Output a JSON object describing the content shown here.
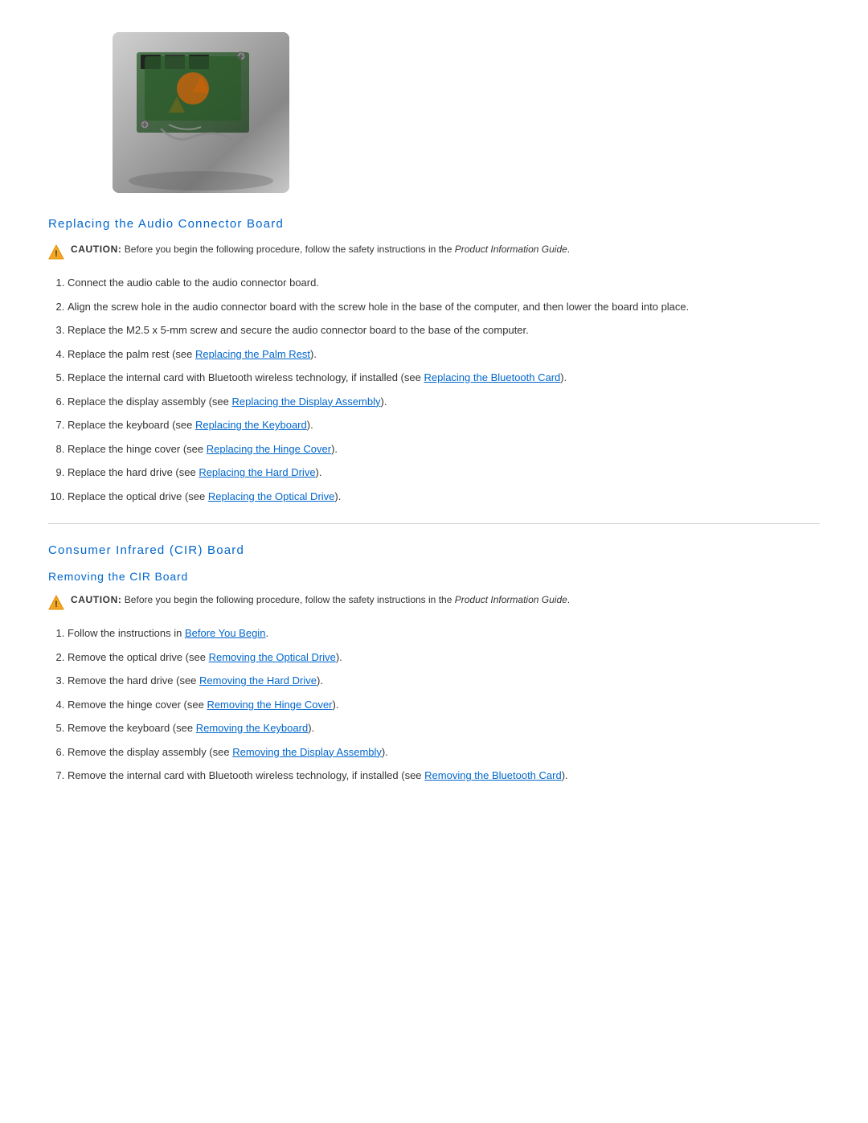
{
  "image": {
    "alt": "Audio connector board hardware image"
  },
  "replacing_section": {
    "heading": "Replacing the Audio Connector Board",
    "caution": {
      "label": "CAUTION:",
      "text": "Before you begin the following procedure, follow the safety instructions in the ",
      "guide_name": "Product Information Guide",
      "text_end": "."
    },
    "steps": [
      "Connect the audio cable to the audio connector board.",
      "Align the screw hole in the audio connector board with the screw hole in the base of the computer, and then lower the board into place.",
      "Replace the M2.5 x 5-mm screw and secure the audio connector board to the base of the computer.",
      {
        "text": "Replace the palm rest (see ",
        "link_text": "Replacing the Palm Rest",
        "text_end": ")."
      },
      {
        "text": "Replace the internal card with Bluetooth wireless technology, if installed (see ",
        "link_text": "Replacing the Bluetooth Card",
        "text_end": ")."
      },
      {
        "text": "Replace the display assembly (see ",
        "link_text": "Replacing the Display Assembly",
        "text_end": ")."
      },
      {
        "text": "Replace the keyboard (see ",
        "link_text": "Replacing the Keyboard",
        "text_end": ")."
      },
      {
        "text": "Replace the hinge cover (see ",
        "link_text": "Replacing the Hinge Cover",
        "text_end": ")."
      },
      {
        "text": "Replace the hard drive (see ",
        "link_text": "Replacing the Hard Drive",
        "text_end": ")."
      },
      {
        "text": "Replace the optical drive (see ",
        "link_text": "Replacing the Optical Drive",
        "text_end": ")."
      }
    ]
  },
  "cir_section": {
    "heading": "Consumer Infrared (CIR) Board",
    "removing_heading": "Removing the CIR Board",
    "caution": {
      "label": "CAUTION:",
      "text": "Before you begin the following procedure, follow the safety instructions in the ",
      "guide_name": "Product Information Guide",
      "text_end": "."
    },
    "steps": [
      {
        "text": "Follow the instructions in ",
        "link_text": "Before You Begin",
        "text_end": "."
      },
      {
        "text": "Remove the optical drive (see ",
        "link_text": "Removing the Optical Drive",
        "text_end": ")."
      },
      {
        "text": "Remove the hard drive (see ",
        "link_text": "Removing the Hard Drive",
        "text_end": ")."
      },
      {
        "text": "Remove the hinge cover (see ",
        "link_text": "Removing the Hinge Cover",
        "text_end": ")."
      },
      {
        "text": "Remove the keyboard (see ",
        "link_text": "Removing the Keyboard",
        "text_end": ")."
      },
      {
        "text": "Remove the display assembly (see ",
        "link_text": "Removing the Display Assembly",
        "text_end": ")."
      },
      {
        "text": "Remove the internal card with Bluetooth wireless technology, if installed (see ",
        "link_text": "Removing the Bluetooth Card",
        "text_end": ")."
      }
    ]
  }
}
